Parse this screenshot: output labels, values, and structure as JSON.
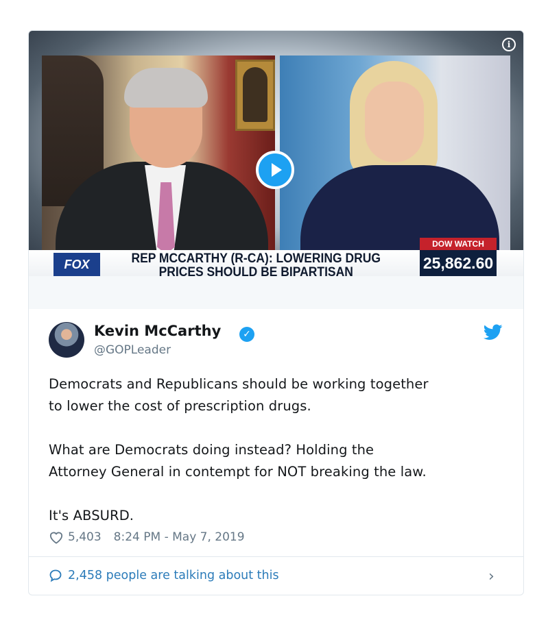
{
  "media": {
    "chyron_line1": "REP MCCARTHY (R-CA): LOWERING DRUG",
    "chyron_line2": "PRICES SHOULD BE BIPARTISAN",
    "network_logo": "FOX",
    "ticker_label": "DOW WATCH",
    "ticker_value": "25,862.60",
    "play_icon": "play-icon",
    "info_icon": "info-icon"
  },
  "tweet": {
    "author_name": "Kevin McCarthy",
    "author_handle": "@GOPLeader",
    "verified_icon": "verified-badge-icon",
    "text": "Democrats and Republicans should be working together\nto lower the cost of prescription drugs.\n\nWhat are Democrats doing instead? Holding the\nAttorney General in contempt for NOT breaking the law.\n\nIt's ABSURD.",
    "likes": "5,403",
    "timestamp": "8:24 PM - May 7, 2019",
    "talking": "2,458 people are talking about this"
  },
  "colors": {
    "twitter_blue": "#1da1f2",
    "link_blue": "#2b7bb9",
    "meta_gray": "#657786"
  }
}
